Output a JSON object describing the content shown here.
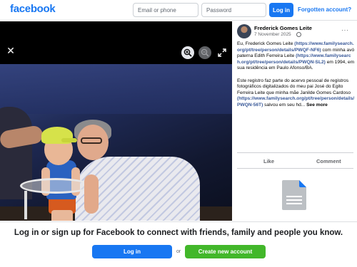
{
  "header": {
    "logo": "facebook",
    "email_placeholder": "Email or phone",
    "password_placeholder": "Password",
    "login_label": "Log in",
    "forgot_label": "Forgotten account?"
  },
  "viewer": {
    "close_icon": "close-icon",
    "zoom_in_icon": "zoom-in-icon",
    "zoom_out_icon": "zoom-out-icon",
    "expand_icon": "expand-icon"
  },
  "post": {
    "author": "Frederick Gomes Leite",
    "date": "7 November 2025",
    "privacy_icon": "globe-icon",
    "more_label": "···",
    "p1_a": "Eu, Frederick Gomes Leite",
    "p1_link1": "(https://www.familysearch.org/pt/tree/person/details/PWQF-NF6)",
    "p1_b": "com minha avó paterna Edith Ferreira Leite",
    "p1_link2": "(https://www.familysearch.org/pt/tree/person/details/PWQN-SL2)",
    "p1_c": "em 1994, em sua residência em Paulo Afonso/BA.",
    "p2_a": "Este registro faz parte do acervo pessoal de registros fotográficos digitalizados do meu pai José do Egito Ferreira Leite que minha mãe Janilde Gomes Cardoso",
    "p2_link": "(https://www.familysearch.org/pt/tree/person/details/PWQN-56T)",
    "p2_b": "salvou em seu hd...",
    "see_more": "See more",
    "like_label": "Like",
    "comment_label": "Comment",
    "attachment_icon": "document-icon"
  },
  "banner": {
    "text": "Log in or sign up for Facebook to connect with friends, family and people you know.",
    "login_label": "Log in",
    "or_label": "or",
    "create_label": "Create new account"
  },
  "colors": {
    "brand": "#1877f2",
    "create": "#42b72a",
    "link": "#385898"
  }
}
